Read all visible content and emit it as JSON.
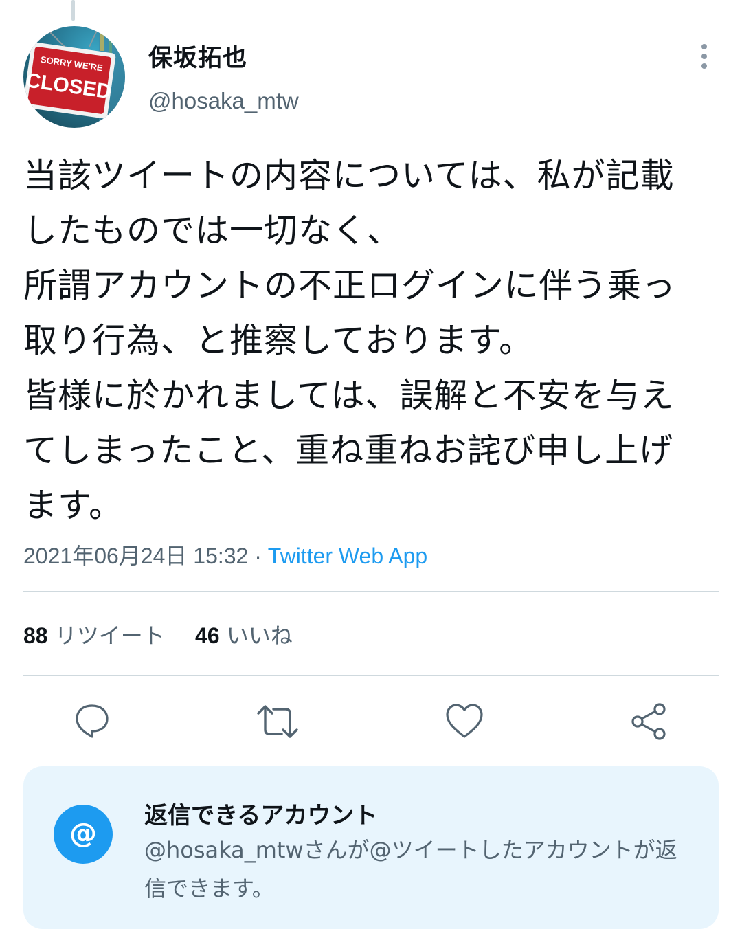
{
  "tweet": {
    "author": {
      "display_name": "保坂拓也",
      "handle": "@hosaka_mtw",
      "avatar_sign_text": [
        "SORRY WE'RE",
        "CLOSED"
      ]
    },
    "body_lines": [
      "当該ツイートの内容については、私が記載",
      "したものでは一切なく、",
      "所謂アカウントの不正ログインに伴う乗っ",
      "取り行為、と推察しております。",
      "皆様に於かれましては、誤解と不安を与え",
      "てしまったこと、重ね重ねお詫び申し上げ",
      "ます。"
    ],
    "timestamp": "2021年06月24日 15:32",
    "separator": " · ",
    "source": "Twitter Web App"
  },
  "stats": {
    "retweets": {
      "count": "88",
      "label": "リツイート"
    },
    "likes": {
      "count": "46",
      "label": "いいね"
    }
  },
  "actions": [
    {
      "name": "reply",
      "icon": "reply-bubble-icon"
    },
    {
      "name": "retweet",
      "icon": "retweet-icon"
    },
    {
      "name": "like",
      "icon": "heart-icon"
    },
    {
      "name": "share",
      "icon": "share-icon"
    }
  ],
  "reply_restriction": {
    "icon_glyph": "@",
    "title": "返信できるアカウント",
    "description": "@hosaka_mtwさんが@ツイートしたアカウントが返信できます。"
  },
  "colors": {
    "accent": "#1d9bf0",
    "muted_text": "#536471",
    "panel_bg": "#e8f5fd",
    "icon_gray": "#536471"
  }
}
